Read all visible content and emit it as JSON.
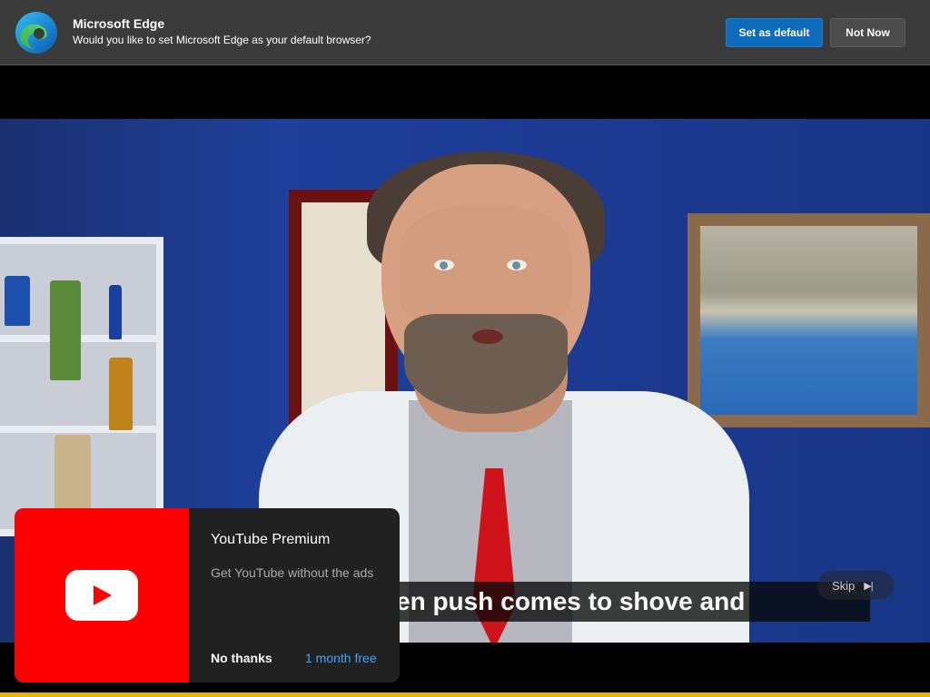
{
  "edge_infobar": {
    "title": "Microsoft Edge",
    "message": "Would you like to set Microsoft Edge as your default browser?",
    "primary_button": "Set as default",
    "secondary_button": "Not Now",
    "accent_color": "#0f6cbd",
    "icon": "edge-logo-icon"
  },
  "video": {
    "caption": "en push comes to shove and",
    "skip_label": "Skip",
    "skip_icon": "skip-next-icon",
    "progress_color": "#e3b600"
  },
  "promo": {
    "title": "YouTube Premium",
    "description": "Get YouTube without the ads",
    "dismiss_label": "No thanks",
    "action_label": "1 month free",
    "brand_color": "#ff0000",
    "icon": "youtube-logo-icon"
  }
}
